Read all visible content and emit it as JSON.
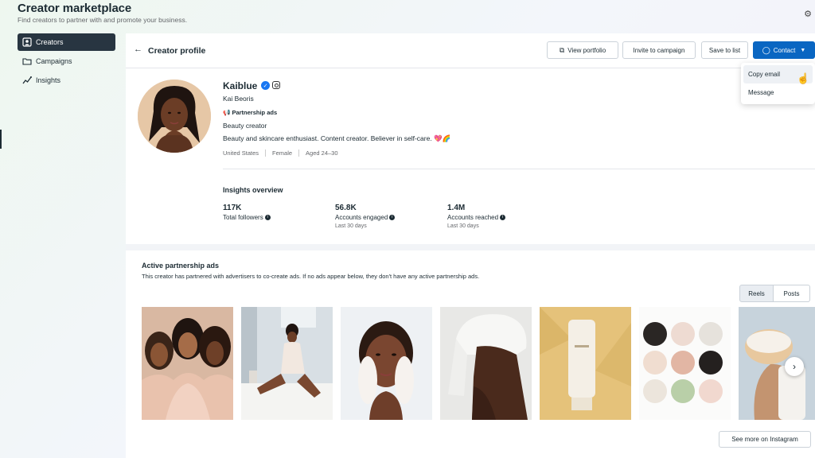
{
  "app": {
    "title": "Creator marketplace",
    "subtitle": "Find creators to partner with and promote your business."
  },
  "sidebar": {
    "items": [
      {
        "label": "Creators",
        "icon": "creators-icon",
        "active": true
      },
      {
        "label": "Campaigns",
        "icon": "folder-icon",
        "active": false
      },
      {
        "label": "Insights",
        "icon": "insights-icon",
        "active": false
      }
    ]
  },
  "profile_header": {
    "title": "Creator profile",
    "buttons": {
      "view_portfolio": "View portfolio",
      "invite": "Invite to campaign",
      "save": "Save to list",
      "contact": "Contact"
    }
  },
  "contact_menu": {
    "items": [
      "Copy email",
      "Message"
    ]
  },
  "creator": {
    "handle": "Kaiblue",
    "name": "Kai Beoris",
    "badge": "Partnership ads",
    "category": "Beauty creator",
    "bio": "Beauty and skincare enthusiast.  Content creator. Believer in self-care. 💖🌈",
    "country": "United States",
    "gender": "Female",
    "age": "Aged 24–30"
  },
  "insights": {
    "title": "Insights overview",
    "stats": [
      {
        "value": "117K",
        "label": "Total followers",
        "sub": ""
      },
      {
        "value": "56.8K",
        "label": "Accounts engaged",
        "sub": "Last 30 days"
      },
      {
        "value": "1.4M",
        "label": "Accounts reached",
        "sub": "Last 30 days"
      }
    ]
  },
  "partnership": {
    "title": "Active partnership ads",
    "description": "This creator has partnered with advertisers to co-create ads. If no ads appear below, they don't have any active partnership ads.",
    "tabs": [
      "Reels",
      "Posts"
    ],
    "active_tab": "Reels",
    "tiles": [
      "group-portrait",
      "woman-applying-lotion",
      "face-cleansing",
      "towel-wrap",
      "cream-tube",
      "cosmetic-jars",
      "jar-in-hand"
    ],
    "see_more": "See more on Instagram"
  },
  "colors": {
    "primary": "#0a66c2",
    "sidebar_active": "#283541",
    "verified": "#1877f2"
  }
}
